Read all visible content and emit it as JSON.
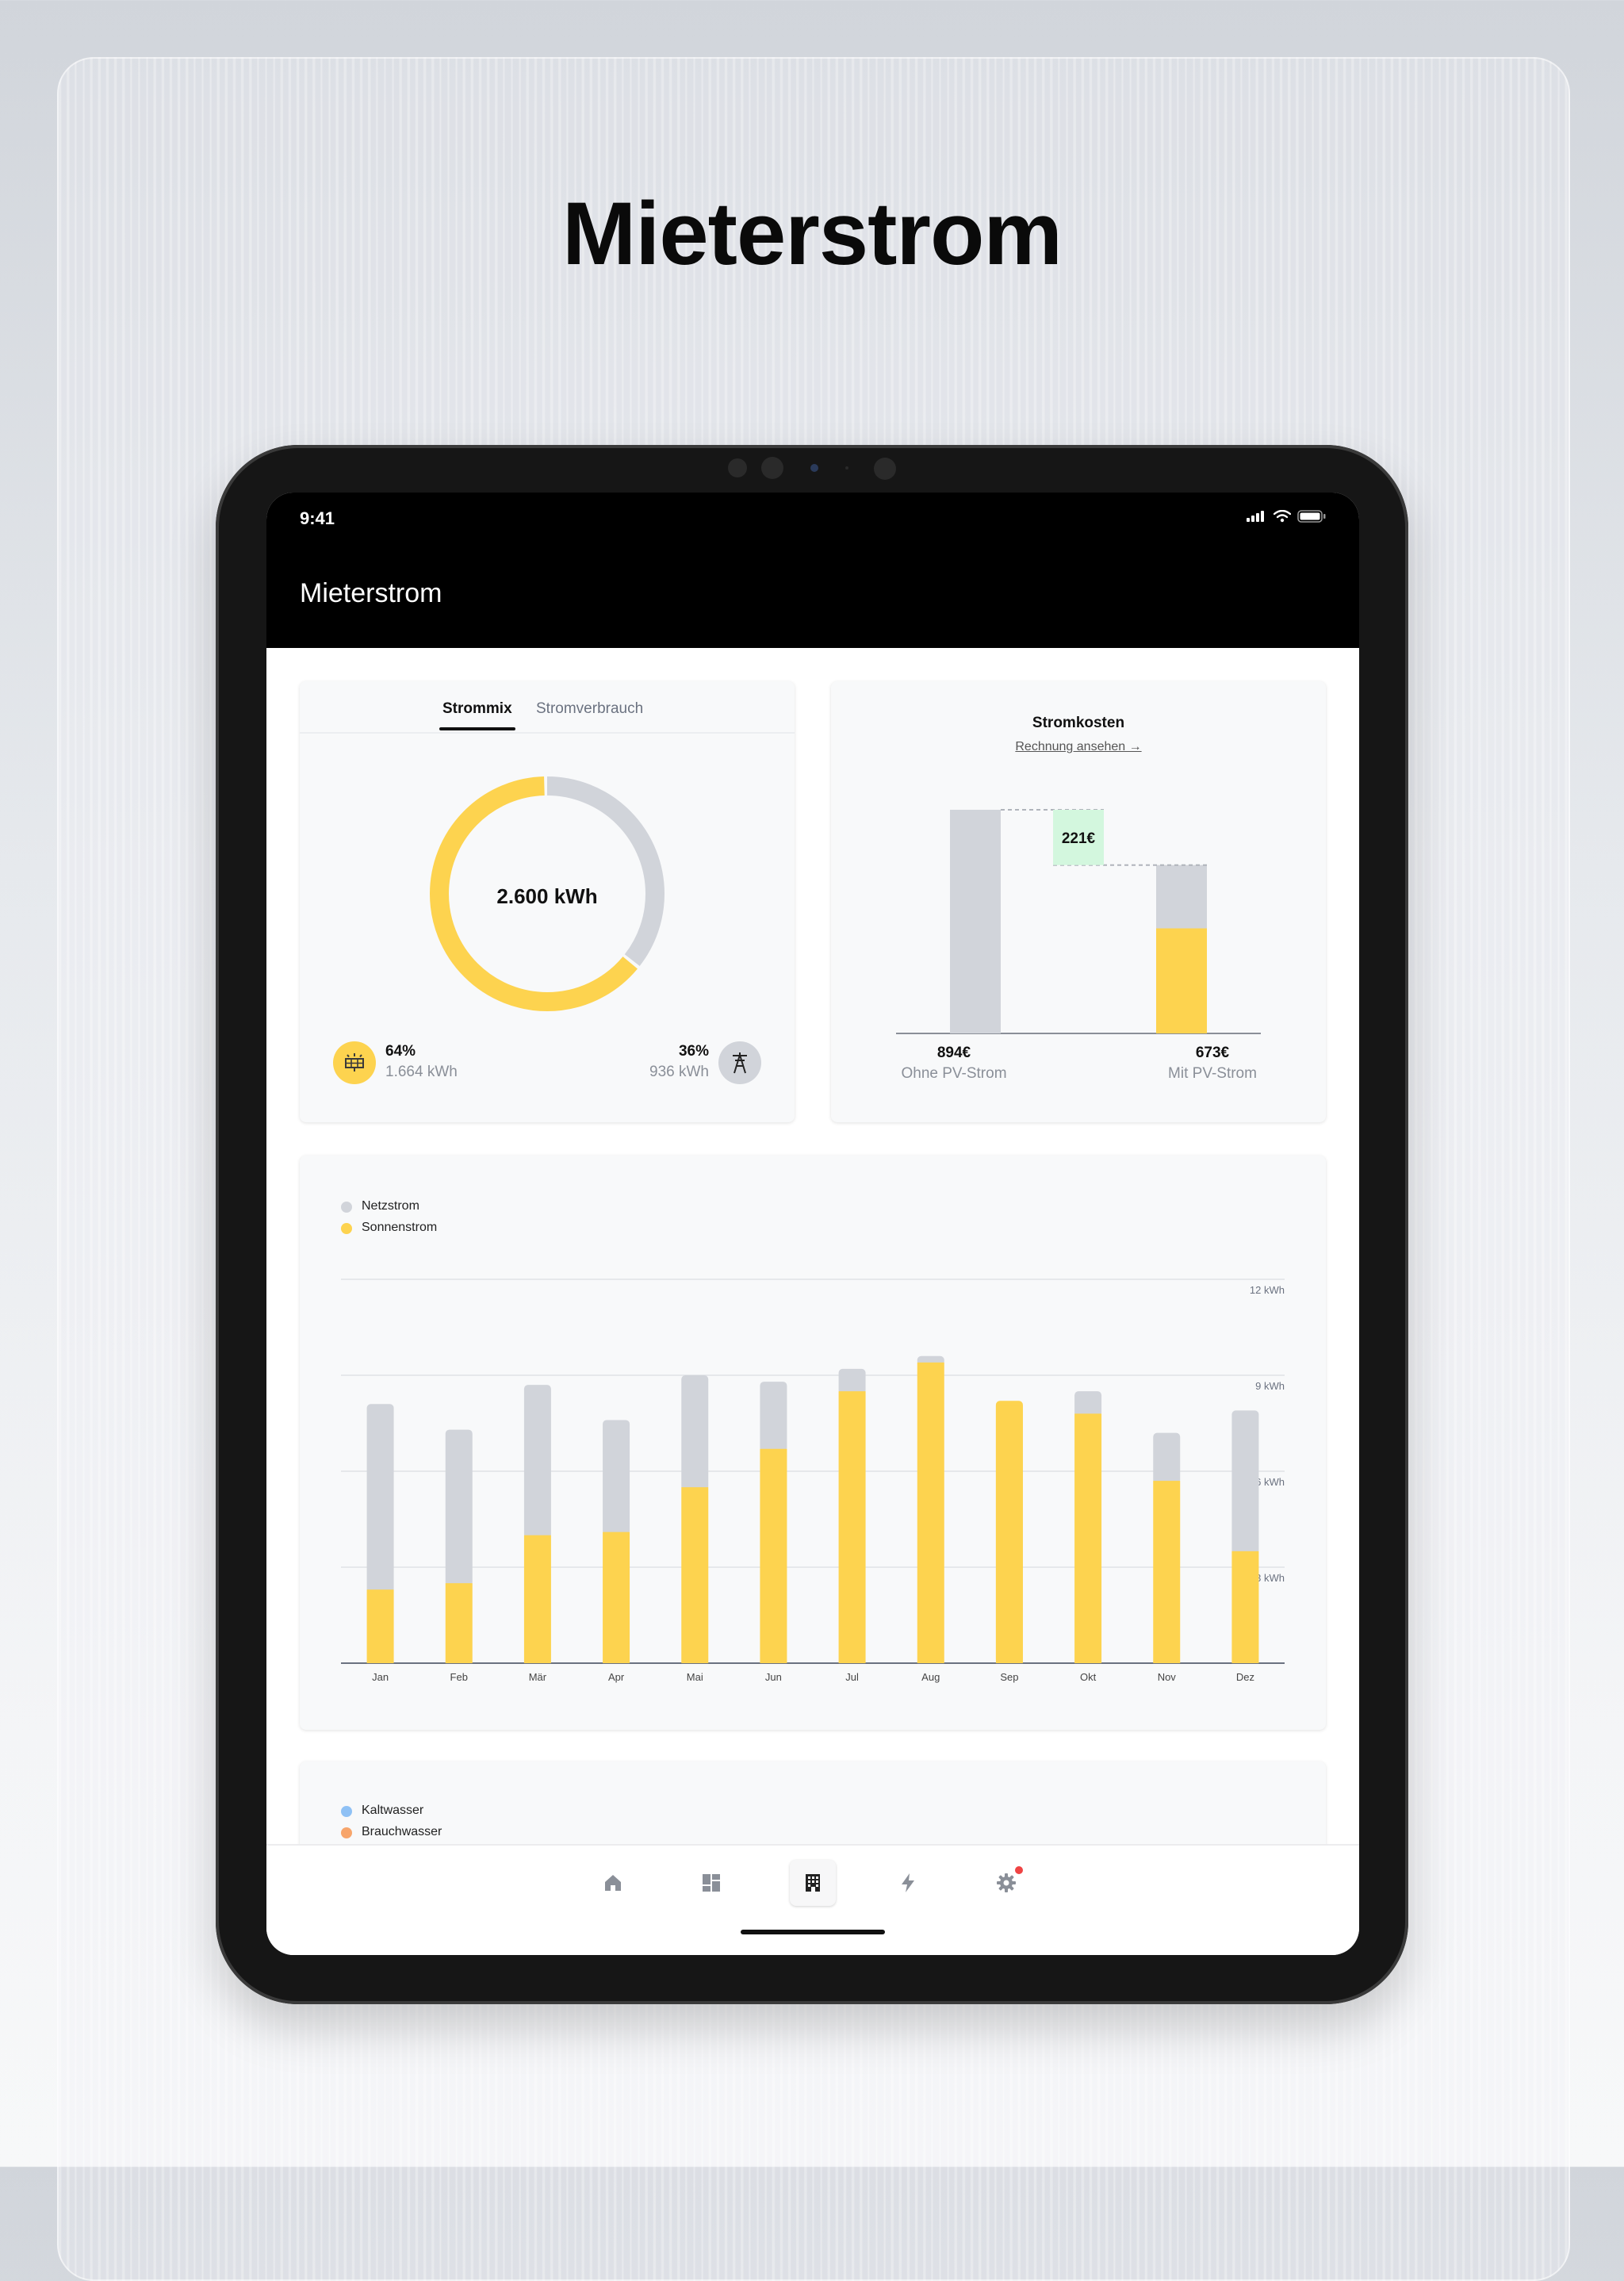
{
  "headline": "Mieterstrom",
  "status_bar": {
    "time": "9:41"
  },
  "nav": {
    "title": "Mieterstrom"
  },
  "strommix": {
    "tabs": [
      "Strommix",
      "Stromverbrauch"
    ],
    "active_tab": "Strommix",
    "total": "2.600 kWh",
    "solar": {
      "percent": "64%",
      "amount": "1.664 kWh",
      "share": 0.64,
      "color": "#fdd34f",
      "icon": "solar-panel-icon"
    },
    "grid": {
      "percent": "36%",
      "amount": "936 kWh",
      "share": 0.36,
      "color": "#d1d4da",
      "icon": "power-tower-icon"
    }
  },
  "stromkosten": {
    "title": "Stromkosten",
    "link": "Rechnung ansehen →",
    "savings": "221€",
    "without": {
      "value": "894€",
      "label": "Ohne PV-Strom",
      "amount": 894
    },
    "with": {
      "value": "673€",
      "label": "Mit PV-Strom",
      "amount": 673,
      "solar_part": 420
    },
    "colors": {
      "grid": "#d1d4da",
      "solar": "#fdd34f",
      "savings": "#d3f7de"
    }
  },
  "chart_data": {
    "type": "bar",
    "stacked": true,
    "legend": [
      "Netzstrom",
      "Sonnenstrom"
    ],
    "legend_placement": "top-left",
    "categories": [
      "Jan",
      "Feb",
      "Mär",
      "Apr",
      "Mai",
      "Jun",
      "Jul",
      "Aug",
      "Sep",
      "Okt",
      "Nov",
      "Dez"
    ],
    "series": [
      {
        "name": "Sonnenstrom",
        "color": "#fdd34f",
        "values": [
          2.3,
          2.5,
          4.0,
          4.1,
          5.5,
          6.7,
          8.5,
          9.4,
          8.2,
          7.8,
          5.7,
          3.5
        ]
      },
      {
        "name": "Netzstrom",
        "color": "#d1d4da",
        "values": [
          5.8,
          4.8,
          4.7,
          3.5,
          3.5,
          2.1,
          0.7,
          0.2,
          0.0,
          0.7,
          1.5,
          4.4
        ]
      }
    ],
    "ylim": [
      0,
      12
    ],
    "yticks": [
      {
        "value": 3,
        "label": "3 kWh"
      },
      {
        "value": 6,
        "label": "6 kWh"
      },
      {
        "value": 9,
        "label": "9 kWh"
      },
      {
        "value": 12,
        "label": "12 kWh"
      }
    ],
    "grid": true
  },
  "water": {
    "legend": [
      {
        "name": "Kaltwasser",
        "color": "#8fc1f5"
      },
      {
        "name": "Brauchwasser",
        "color": "#f7a56b"
      }
    ]
  },
  "tabbar": {
    "items": [
      {
        "icon": "home-icon",
        "active": false
      },
      {
        "icon": "dashboard-icon",
        "active": false
      },
      {
        "icon": "building-icon",
        "active": true
      },
      {
        "icon": "bolt-icon",
        "active": false
      },
      {
        "icon": "settings-icon",
        "active": false,
        "badge": true
      }
    ],
    "badge_color": "#ef4444"
  }
}
